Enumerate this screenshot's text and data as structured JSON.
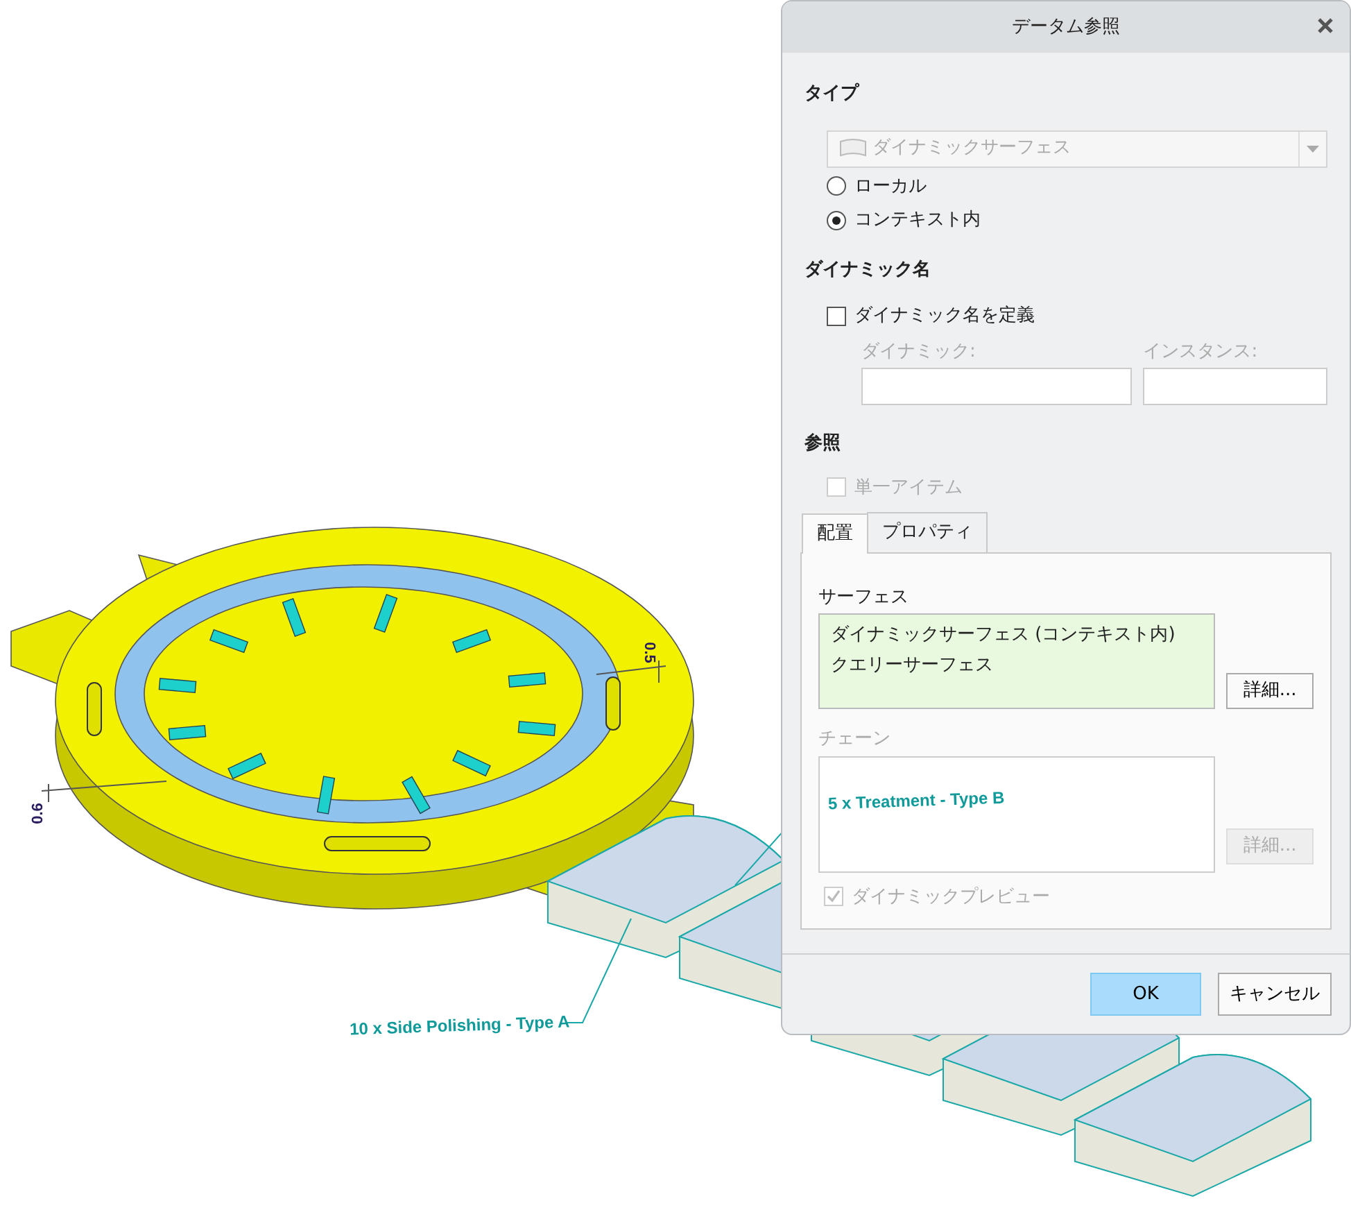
{
  "model": {
    "annotations": [
      {
        "kind": "dimension",
        "text": "0.5"
      },
      {
        "kind": "dimension",
        "text": "0.6"
      },
      {
        "kind": "note",
        "text": "10 x Side Polishing - Type A"
      },
      {
        "kind": "note",
        "text": "5 x Treatment - Type B"
      }
    ]
  },
  "dialog": {
    "title": "データム参照",
    "type_section": {
      "label": "タイプ",
      "dropdown": {
        "value": "ダイナミックサーフェス",
        "disabled": true
      },
      "options": [
        {
          "label": "ローカル",
          "selected": false
        },
        {
          "label": "コンテキスト内",
          "selected": true
        }
      ]
    },
    "dynamic_name_section": {
      "label": "ダイナミック名",
      "define_checkbox": {
        "label": "ダイナミック名を定義",
        "checked": false
      },
      "fields": [
        {
          "label": "ダイナミック:",
          "disabled": true
        },
        {
          "label": "インスタンス:",
          "disabled": true
        }
      ]
    },
    "reference_section": {
      "label": "参照",
      "single_item": {
        "label": "単一アイテム",
        "checked": false,
        "disabled": true
      },
      "tabs": [
        {
          "label": "配置",
          "selected": true
        },
        {
          "label": "プロパティ",
          "selected": false
        }
      ],
      "surfaces": {
        "label": "サーフェス",
        "disabled": false,
        "items": [
          "ダイナミックサーフェス (コンテキスト内)",
          "クエリーサーフェス"
        ],
        "details_button": {
          "label": "詳細...",
          "disabled": false
        }
      },
      "chain": {
        "label": "チェーン",
        "disabled": true,
        "details_button": {
          "label": "詳細...",
          "disabled": true
        }
      },
      "dynamic_preview": {
        "label": "ダイナミックプレビュー",
        "checked": true,
        "disabled": true
      }
    },
    "buttons": [
      {
        "label": "OK",
        "default": true
      },
      {
        "label": "キャンセル",
        "default": false
      }
    ]
  }
}
